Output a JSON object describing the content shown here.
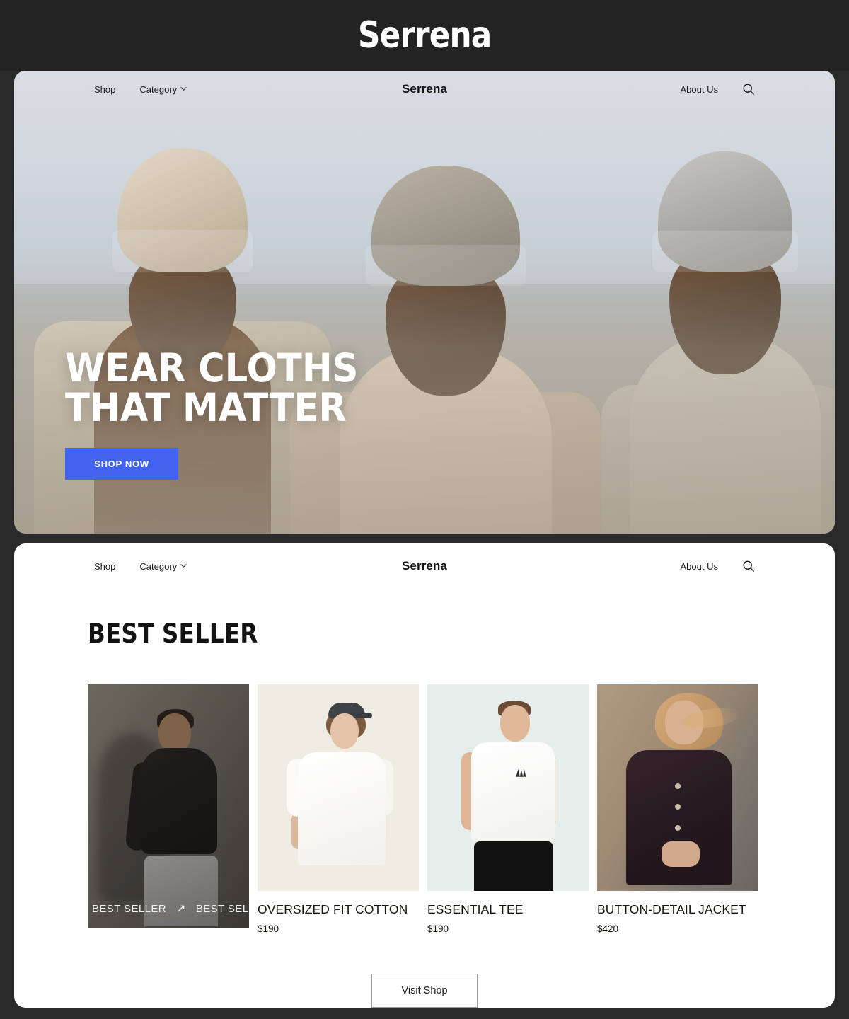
{
  "brand": {
    "wordmark": "Serrena"
  },
  "hero_nav": {
    "shop_label": "Shop",
    "category_label": "Category",
    "logo": "Serrena",
    "about_label": "About Us",
    "search_icon": "search-icon",
    "chevron_icon": "chevron-down-icon"
  },
  "hero": {
    "title_line1": "WEAR CLOTHS",
    "title_line2": "THAT MATTER",
    "cta_label": "SHOP NOW",
    "cta_color": "#4263ef"
  },
  "content_nav": {
    "shop_label": "Shop",
    "category_label": "Category",
    "logo": "Serrena",
    "about_label": "About Us",
    "search_icon": "search-icon",
    "chevron_icon": "chevron-down-icon"
  },
  "best_seller": {
    "section_title": "BEST SELLER",
    "badge_text": "BEST SELLER",
    "badge_arrow": "↗",
    "products": [
      {
        "name": "",
        "price": ""
      },
      {
        "name": "OVERSIZED FIT COTTON",
        "price": "$190"
      },
      {
        "name": "ESSENTIAL TEE",
        "price": "$190"
      },
      {
        "name": "BUTTON-DETAIL JACKET",
        "price": "$420"
      }
    ],
    "visit_shop_label": "Visit Shop"
  },
  "theme": {
    "page_background": "#2a2a2a",
    "panel_background": "#ffffff",
    "accent": "#4263ef",
    "text": "#16160f"
  }
}
